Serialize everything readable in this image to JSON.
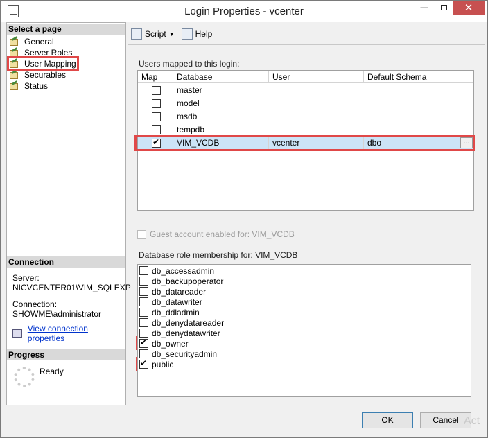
{
  "window": {
    "title": "Login Properties - vcenter",
    "minimize": "—",
    "close": "✕"
  },
  "left": {
    "select_header": "Select a page",
    "pages": [
      {
        "label": "General"
      },
      {
        "label": "Server Roles"
      },
      {
        "label": "User Mapping"
      },
      {
        "label": "Securables"
      },
      {
        "label": "Status"
      }
    ],
    "connection_header": "Connection",
    "server_label": "Server:",
    "server_value": "NICVCENTER01\\VIM_SQLEXP",
    "connection_label": "Connection:",
    "connection_value": "SHOWME\\administrator",
    "view_link": "View connection properties",
    "progress_header": "Progress",
    "progress_status": "Ready"
  },
  "toolbar": {
    "script_label": "Script",
    "help_label": "Help"
  },
  "mapping": {
    "label": "Users mapped to this login:",
    "columns": [
      "Map",
      "Database",
      "User",
      "Default Schema"
    ],
    "rows": [
      {
        "checked": false,
        "database": "master",
        "user": "",
        "schema": ""
      },
      {
        "checked": false,
        "database": "model",
        "user": "",
        "schema": ""
      },
      {
        "checked": false,
        "database": "msdb",
        "user": "",
        "schema": ""
      },
      {
        "checked": false,
        "database": "tempdb",
        "user": "",
        "schema": ""
      },
      {
        "checked": true,
        "database": "VIM_VCDB",
        "user": "vcenter",
        "schema": "dbo",
        "ellipsis": "..."
      }
    ]
  },
  "guest": {
    "label": "Guest account enabled for: VIM_VCDB",
    "checked": false
  },
  "roles": {
    "label": "Database role membership for: VIM_VCDB",
    "items": [
      {
        "name": "db_accessadmin",
        "checked": false
      },
      {
        "name": "db_backupoperator",
        "checked": false
      },
      {
        "name": "db_datareader",
        "checked": false
      },
      {
        "name": "db_datawriter",
        "checked": false
      },
      {
        "name": "db_ddladmin",
        "checked": false
      },
      {
        "name": "db_denydatareader",
        "checked": false
      },
      {
        "name": "db_denydatawriter",
        "checked": false
      },
      {
        "name": "db_owner",
        "checked": true
      },
      {
        "name": "db_securityadmin",
        "checked": false
      },
      {
        "name": "public",
        "checked": true
      }
    ]
  },
  "buttons": {
    "ok": "OK",
    "cancel": "Cancel"
  },
  "watermark": "Act",
  "colors": {
    "highlight": "#e04848",
    "selected_row": "#cce4f7"
  }
}
